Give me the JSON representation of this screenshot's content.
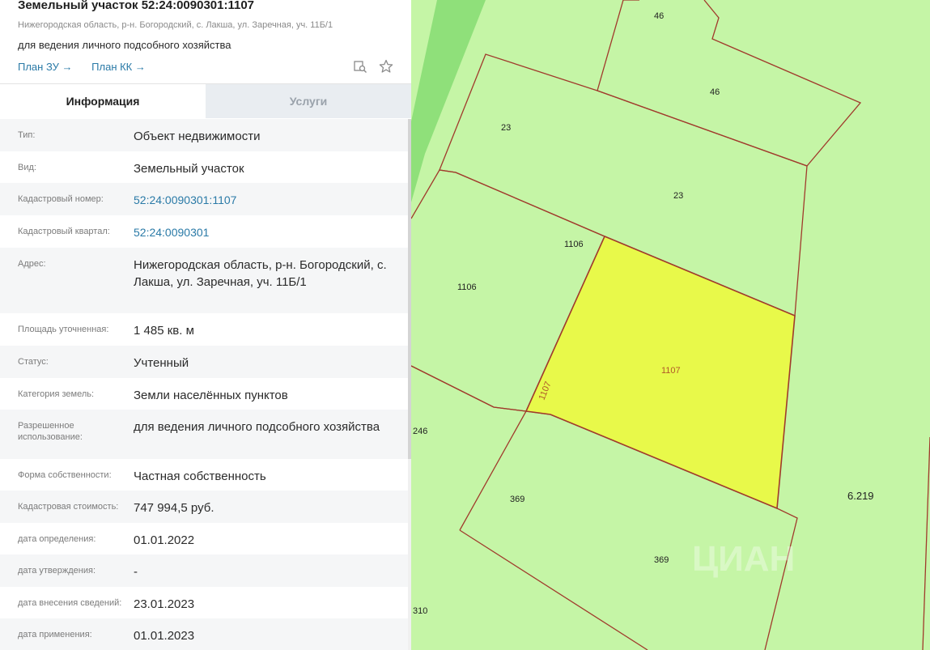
{
  "header": {
    "title": "Земельный участок 52:24:0090301:1107",
    "address_short": "Нижегородская область, р-н. Богородский, с. Лакша, ул. Заречная, уч. 11Б/1",
    "use": "для ведения личного подсобного хозяйства",
    "link_plan_zu": "План ЗУ →",
    "link_plan_kk": "План КК →",
    "icons": [
      "map-search-icon",
      "star-icon"
    ]
  },
  "tabs": [
    {
      "label": "Информация",
      "active": true
    },
    {
      "label": "Услуги",
      "active": false
    }
  ],
  "rows": [
    {
      "label": "Тип:",
      "value": "Объект недвижимости"
    },
    {
      "label": "Вид:",
      "value": "Земельный участок"
    },
    {
      "label": "Кадастровый номер:",
      "value": "52:24:0090301:1107",
      "link": true
    },
    {
      "label": "Кадастровый квартал:",
      "value": "52:24:0090301",
      "link": true
    },
    {
      "label": "Адрес:",
      "value": "Нижегородская область, р-н. Богородский, с. Лакша, ул. Заречная, уч. 11Б/1"
    },
    {
      "label": "Площадь уточненная:",
      "value": "1 485 кв. м"
    },
    {
      "label": "Статус:",
      "value": "Учтенный"
    },
    {
      "label": "Категория земель:",
      "value": "Земли населённых пунктов"
    },
    {
      "label": "Разрешенное использование:",
      "value": "для ведения личного подсобного хозяйства"
    },
    {
      "label": "Форма собственности:",
      "value": "Частная собственность"
    },
    {
      "label": "Кадастровая стоимость:",
      "value": "747 994,5 руб."
    },
    {
      "label": "дата определения:",
      "value": "01.01.2022"
    },
    {
      "label": "дата утверждения:",
      "value": "-"
    },
    {
      "label": "дата внесения сведений:",
      "value": "23.01.2023"
    },
    {
      "label": "дата применения:",
      "value": "01.01.2023"
    }
  ],
  "map": {
    "colors": {
      "background": "#c5f5a6",
      "selected": "#e8f94a",
      "border": "#a03a2c",
      "road": "#8fe07a"
    },
    "labels": {
      "p46a": "46",
      "p46b": "46",
      "p23a": "23",
      "p23b": "23",
      "p1106a": "1106",
      "p1106b": "1106",
      "p1107": "1107",
      "p1107edge": "1107",
      "p246": "246",
      "p369a": "369",
      "p369b": "369",
      "p6219": "6.219",
      "p310": "310"
    },
    "watermark": "ЦИАН"
  }
}
